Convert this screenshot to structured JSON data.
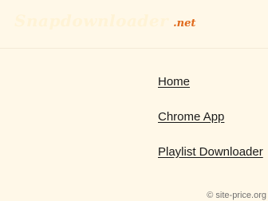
{
  "header": {
    "logo_main": "Snapdownloader",
    "logo_tld": ".net"
  },
  "nav": {
    "items": [
      {
        "label": "Home"
      },
      {
        "label": "Chrome App"
      },
      {
        "label": "Playlist Downloader"
      }
    ]
  },
  "footer": {
    "watermark": "© site-price.org"
  },
  "colors": {
    "background": "#fff8e8",
    "accent": "#e06a1c",
    "link": "#1a1a1a"
  }
}
